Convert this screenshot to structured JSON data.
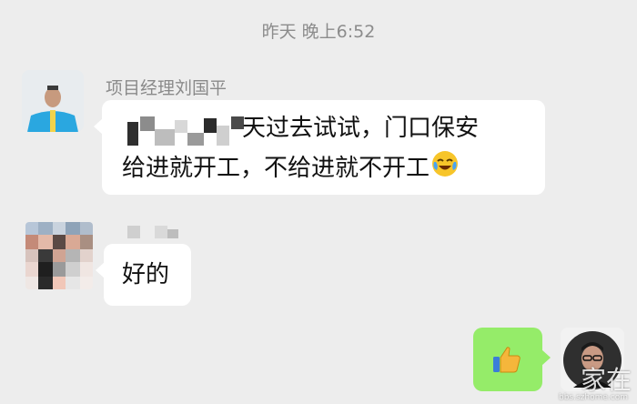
{
  "chat": {
    "timestamp": "昨天 晚上6:52",
    "messages": [
      {
        "sender_name": "项目经理刘国平",
        "text_line1": "明天过去试试，门口保安",
        "text_line2": "给进就开工，不给进就不开工",
        "emoji": "face-with-tears-of-joy"
      },
      {
        "sender_name": "",
        "text": "好的"
      },
      {
        "emoji": "thumbs-up"
      }
    ]
  },
  "watermark": {
    "text": "家在",
    "url": "bbs.szhome.com"
  }
}
